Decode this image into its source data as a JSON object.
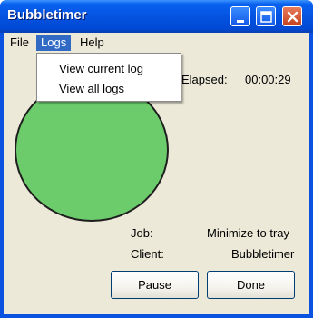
{
  "window": {
    "title": "Bubbletimer"
  },
  "menubar": {
    "items": [
      "File",
      "Logs",
      "Help"
    ]
  },
  "logs_menu": {
    "items": [
      "View current log",
      "View all logs"
    ]
  },
  "status": {
    "elapsed_label": "Elapsed:",
    "elapsed_value": "00:00:29",
    "job_label": "Job:",
    "job_value": "Minimize to tray",
    "client_label": "Client:",
    "client_value": "Bubbletimer"
  },
  "buttons": {
    "pause": "Pause",
    "done": "Done"
  },
  "colors": {
    "bubble": "#6ccc6c",
    "titlebar": "#0453e0",
    "menu_highlight": "#316ac5"
  }
}
